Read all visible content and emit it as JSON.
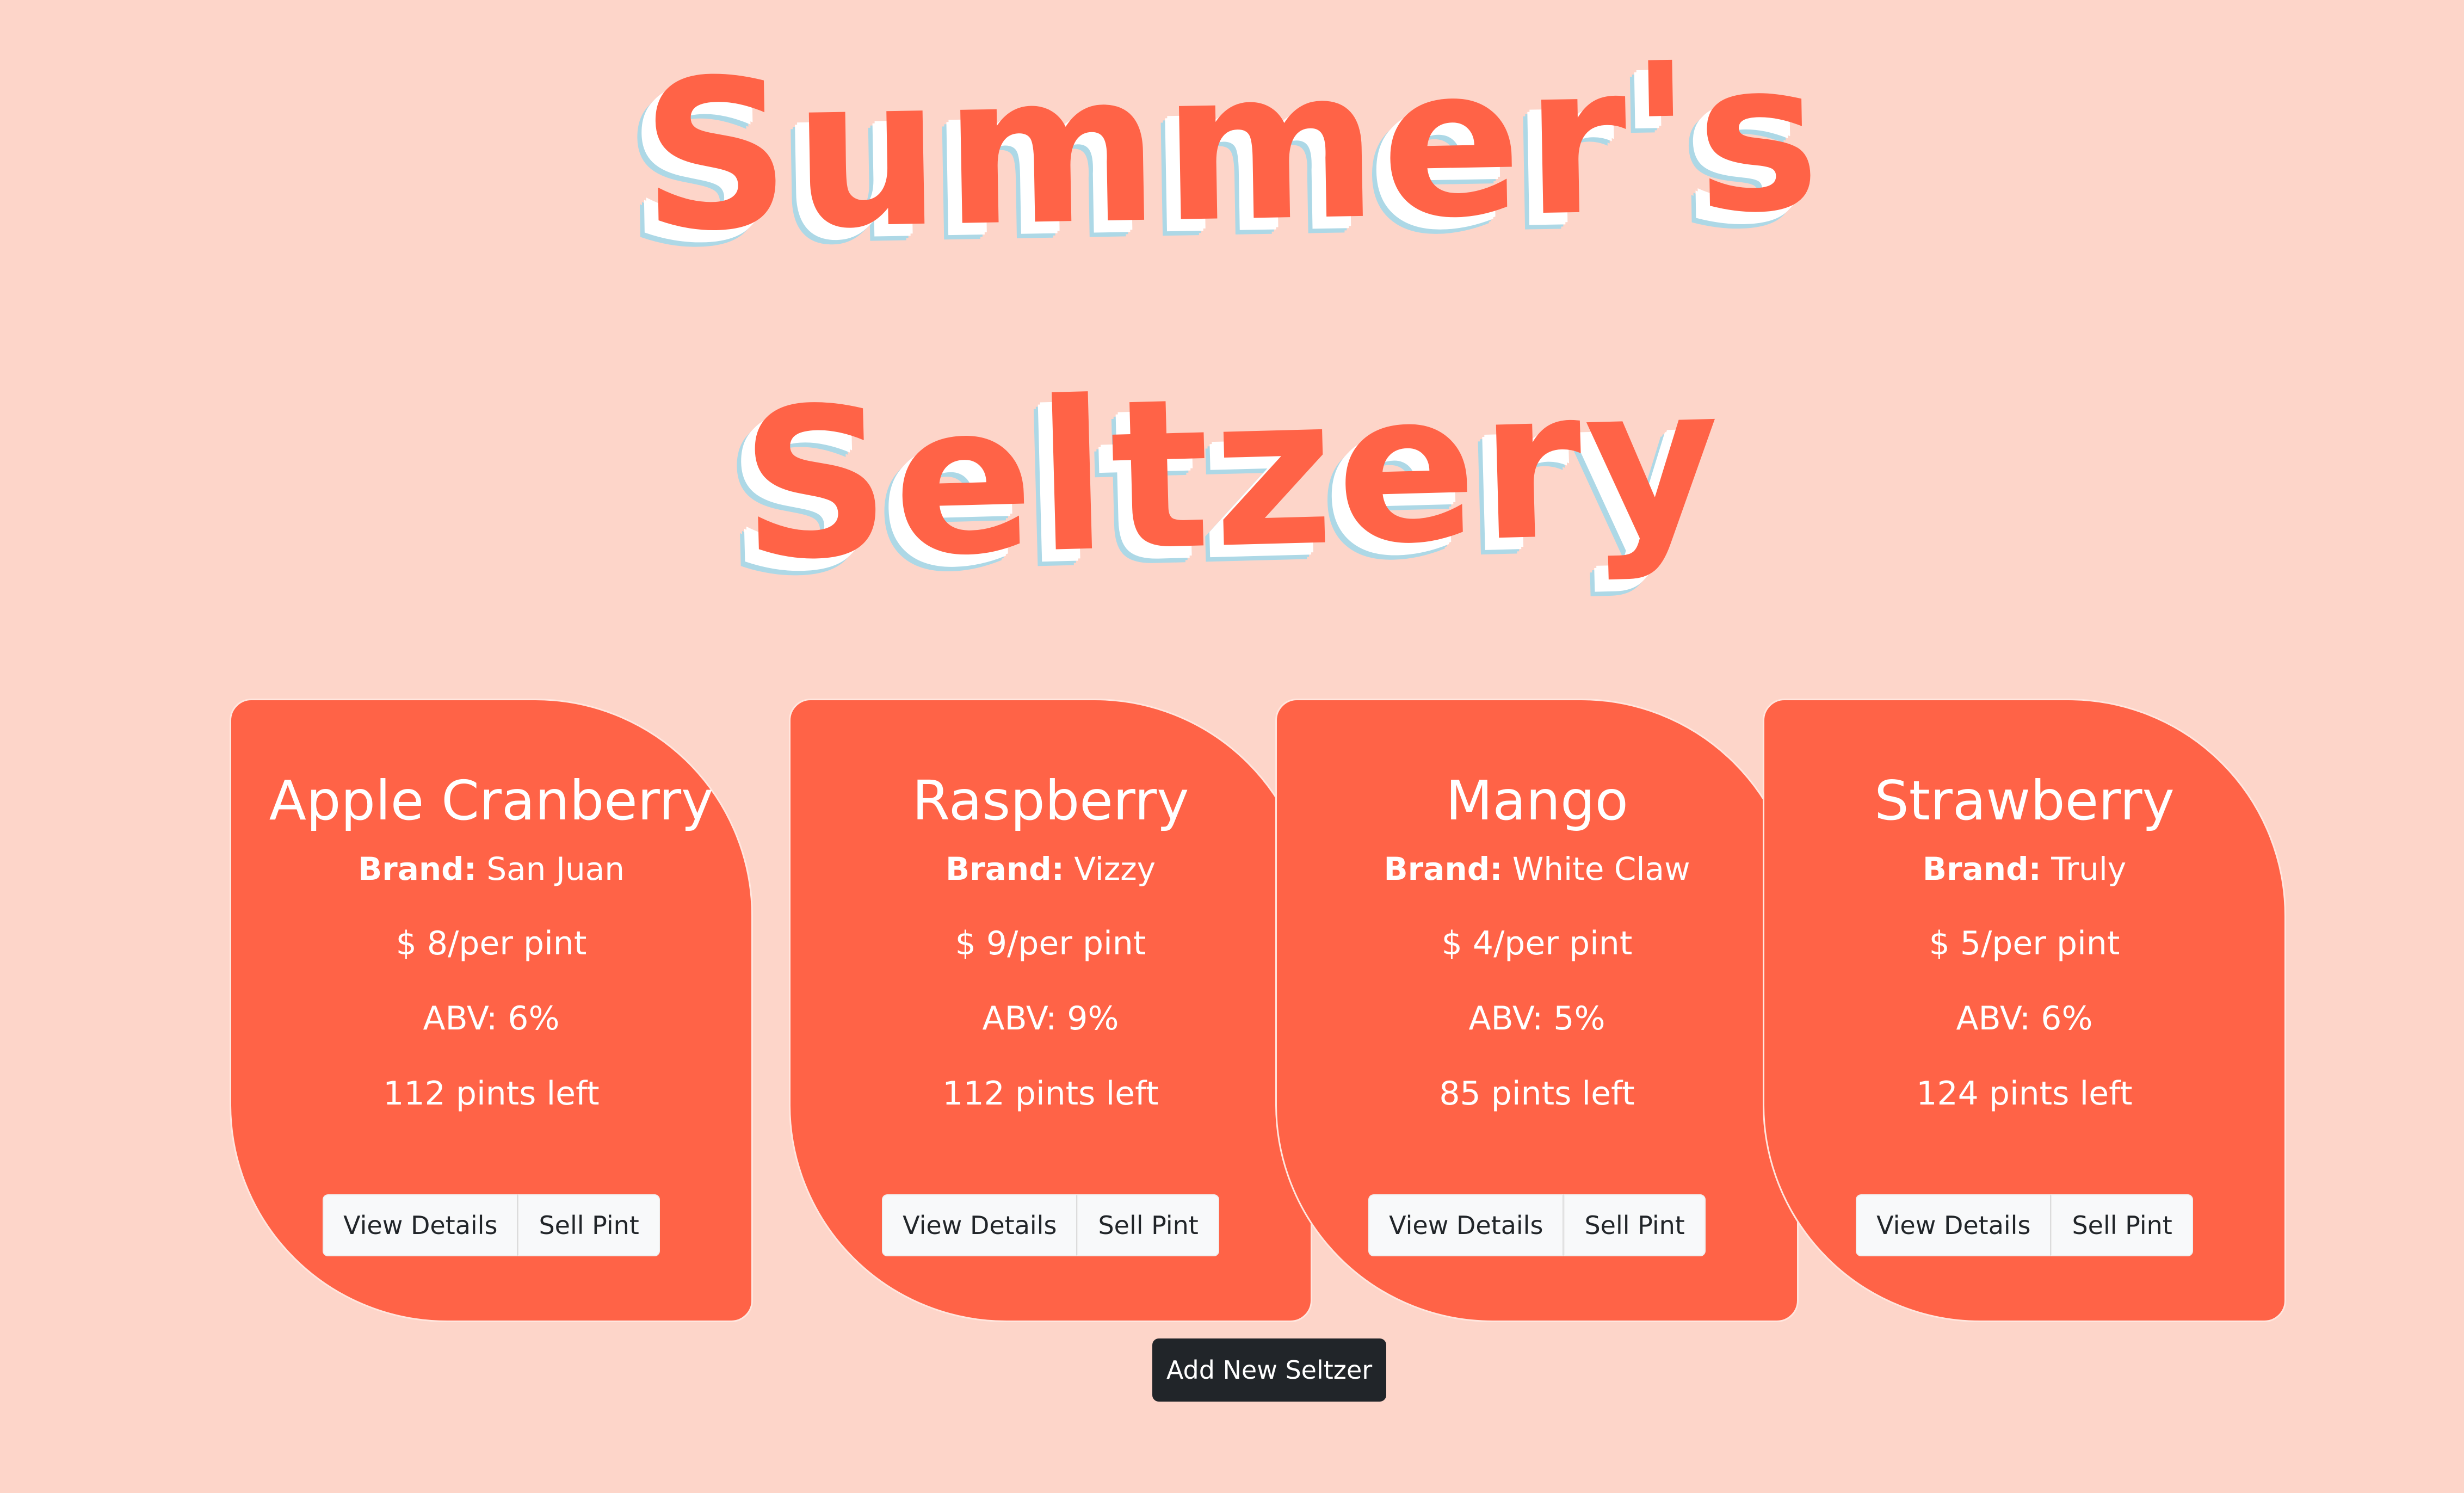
{
  "header": {
    "title_line_1": "Summer's",
    "title_line_2": "Seltzery"
  },
  "cards": [
    {
      "name": "Apple Cranberry",
      "brand_label": "Brand:",
      "brand": "San Juan",
      "price": "$ 8/per pint",
      "abv": "ABV: 6%",
      "pints_left": "112 pints left",
      "view_label": "View Details",
      "sell_label": "Sell Pint"
    },
    {
      "name": "Raspberry",
      "brand_label": "Brand:",
      "brand": "Vizzy",
      "price": "$ 9/per pint",
      "abv": "ABV: 9%",
      "pints_left": "112 pints left",
      "view_label": "View Details",
      "sell_label": "Sell Pint"
    },
    {
      "name": "Mango",
      "brand_label": "Brand:",
      "brand": "White Claw",
      "price": "$ 4/per pint",
      "abv": "ABV: 5%",
      "pints_left": "85 pints left",
      "view_label": "View Details",
      "sell_label": "Sell Pint"
    },
    {
      "name": "Strawberry",
      "brand_label": "Brand:",
      "brand": "Truly",
      "price": "$ 5/per pint",
      "abv": "ABV: 6%",
      "pints_left": "124 pints left",
      "view_label": "View Details",
      "sell_label": "Sell Pint"
    }
  ],
  "actions": {
    "add_label": "Add New Seltzer"
  },
  "colors": {
    "background": "#fdd5c9",
    "accent": "#ff6347",
    "title_shadow_white": "#ffffff",
    "title_shadow_blue": "#add8e6",
    "button_light": "#f8f9fa",
    "button_dark": "#212529"
  }
}
